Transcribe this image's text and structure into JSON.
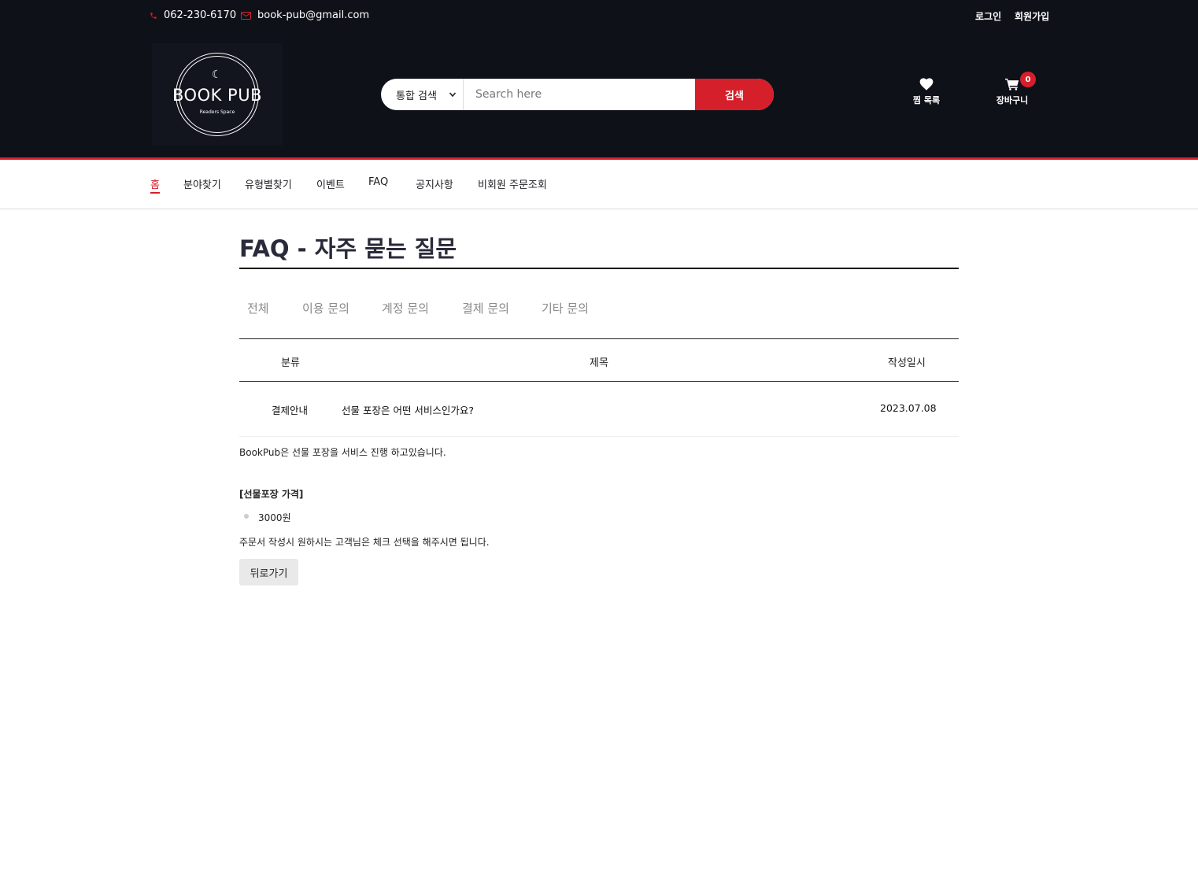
{
  "topbar": {
    "phone": "062-230-6170",
    "email": "book-pub@gmail.com",
    "login": "로그인",
    "signup": "회원가입",
    "phone_icon": "phone-icon",
    "email_icon": "envelope-icon"
  },
  "logo": {
    "title": "BOOK PUB",
    "subtitle": "Readers Space"
  },
  "search": {
    "select_value": "통합 검색",
    "placeholder": "Search here",
    "button": "검색"
  },
  "header_icons": {
    "wishlist": "찜 목록",
    "cart": "장바구니",
    "cart_count": "0"
  },
  "nav": {
    "items": [
      "홈",
      "분야찾기",
      "유형별찾기",
      "이벤트",
      "FAQ",
      "공지사항",
      "비회원 주문조회"
    ]
  },
  "page": {
    "title": "FAQ - 자주 묻는 질문"
  },
  "category_tabs": [
    "전체",
    "이용 문의",
    "계정 문의",
    "결제 문의",
    "기타 문의"
  ],
  "table": {
    "headers": [
      "분류",
      "제목",
      "작성일시"
    ],
    "rows": [
      {
        "category": "결제안내",
        "title": "선물 포장은 어떤 서비스인가요?",
        "date": "2023.07.08"
      }
    ]
  },
  "answer": {
    "line1": "BookPub은 선물 포장을 서비스 진행 하고있습니다.",
    "heading": "[선물포장 가격]",
    "price": "3000원",
    "line2": "주문서 작성시 원하시는 고객님은 체크 선택을 해주시면 됩니다."
  },
  "back_button": "뒤로가기",
  "colors": {
    "accent": "#d51f2b",
    "header_bg": "#0f1119"
  }
}
